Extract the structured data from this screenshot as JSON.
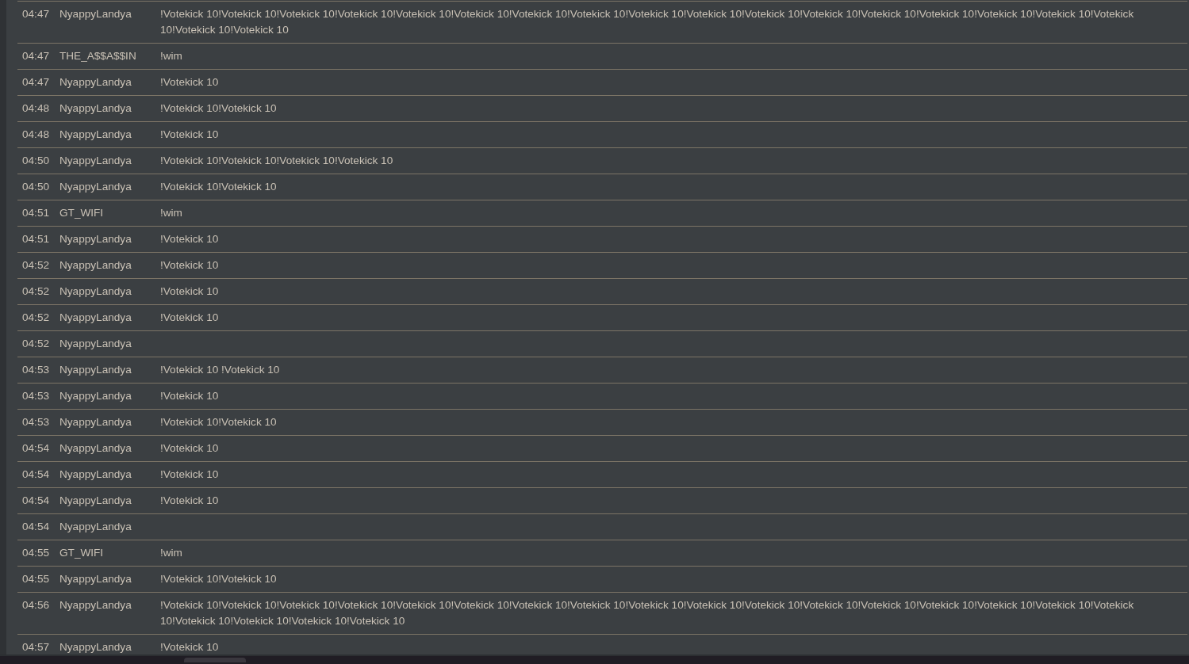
{
  "messages": [
    {
      "time": "04:47",
      "user": "NyappyLandya",
      "message": "!Votekick 10!Votekick 10!Votekick 10!Votekick 10!Votekick 10!Votekick 10!Votekick 10!Votekick 10!Votekick 10!Votekick 10!Votekick 10!Votekick 10!Votekick 10!Votekick 10!Votekick 10!Votekick 10!Votekick 10!Votekick 10!Votekick 10"
    },
    {
      "time": "04:47",
      "user": "THE_A$$A$$IN",
      "message": "!wim"
    },
    {
      "time": "04:47",
      "user": "NyappyLandya",
      "message": "!Votekick 10"
    },
    {
      "time": "04:48",
      "user": "NyappyLandya",
      "message": "!Votekick 10!Votekick 10"
    },
    {
      "time": "04:48",
      "user": "NyappyLandya",
      "message": "!Votekick 10"
    },
    {
      "time": "04:50",
      "user": "NyappyLandya",
      "message": "!Votekick 10!Votekick 10!Votekick 10!Votekick 10"
    },
    {
      "time": "04:50",
      "user": "NyappyLandya",
      "message": "!Votekick 10!Votekick 10"
    },
    {
      "time": "04:51",
      "user": "GT_WIFI",
      "message": "!wim"
    },
    {
      "time": "04:51",
      "user": "NyappyLandya",
      "message": "!Votekick 10"
    },
    {
      "time": "04:52",
      "user": "NyappyLandya",
      "message": "!Votekick 10"
    },
    {
      "time": "04:52",
      "user": "NyappyLandya",
      "message": "!Votekick 10"
    },
    {
      "time": "04:52",
      "user": "NyappyLandya",
      "message": "!Votekick 10"
    },
    {
      "time": "04:52",
      "user": "NyappyLandya"
    },
    {
      "time": "04:53",
      "user": "NyappyLandya",
      "message": "!Votekick 10 !Votekick 10"
    },
    {
      "time": "04:53",
      "user": "NyappyLandya",
      "message": "!Votekick 10"
    },
    {
      "time": "04:53",
      "user": "NyappyLandya",
      "message": "!Votekick 10!Votekick 10"
    },
    {
      "time": "04:54",
      "user": "NyappyLandya",
      "message": "!Votekick 10"
    },
    {
      "time": "04:54",
      "user": "NyappyLandya",
      "message": "!Votekick 10"
    },
    {
      "time": "04:54",
      "user": "NyappyLandya",
      "message": "!Votekick 10"
    },
    {
      "time": "04:54",
      "user": "NyappyLandya"
    },
    {
      "time": "04:55",
      "user": "GT_WIFI",
      "message": "!wim"
    },
    {
      "time": "04:55",
      "user": "NyappyLandya",
      "message": "!Votekick 10!Votekick 10"
    },
    {
      "time": "04:56",
      "user": "NyappyLandya",
      "message": "!Votekick 10!Votekick 10!Votekick 10!Votekick 10!Votekick 10!Votekick 10!Votekick 10!Votekick 10!Votekick 10!Votekick 10!Votekick 10!Votekick 10!Votekick 10!Votekick 10!Votekick 10!Votekick 10!Votekick 10!Votekick 10!Votekick 10!Votekick 10!Votekick 10"
    },
    {
      "time": "04:57",
      "user": "NyappyLandya",
      "message": "!Votekick 10"
    }
  ]
}
